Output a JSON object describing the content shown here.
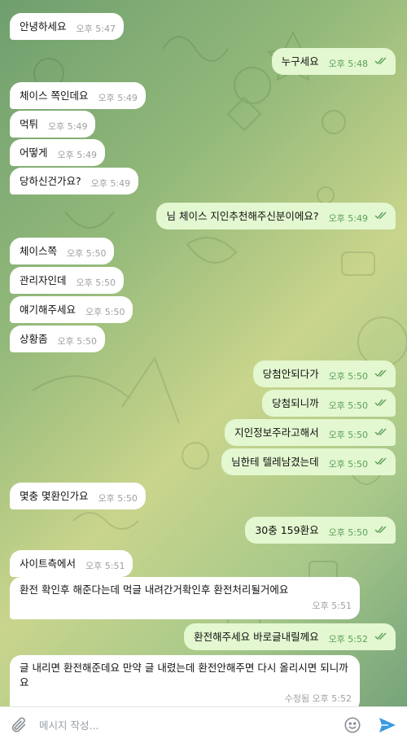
{
  "messages": [
    {
      "dir": "in",
      "text": "안녕하세요",
      "time": "오후 5:47"
    },
    {
      "dir": "out",
      "text": "누구세요",
      "time": "오후 5:48"
    },
    {
      "dir": "in",
      "text": "체이스 쪽인데요",
      "time": "오후 5:49"
    },
    {
      "dir": "in",
      "text": "먹튀",
      "time": "오후 5:49"
    },
    {
      "dir": "in",
      "text": "어떻게",
      "time": "오후 5:49"
    },
    {
      "dir": "in",
      "text": "당하신건가요?",
      "time": "오후 5:49"
    },
    {
      "dir": "out",
      "text": "님 체이스 지인추천해주신분이에요?",
      "time": "오후 5:49"
    },
    {
      "dir": "in",
      "text": "체이스쪽",
      "time": "오후 5:50"
    },
    {
      "dir": "in",
      "text": "관리자인데",
      "time": "오후 5:50"
    },
    {
      "dir": "in",
      "text": "얘기해주세요",
      "time": "오후 5:50"
    },
    {
      "dir": "in",
      "text": "상황좀",
      "time": "오후 5:50"
    },
    {
      "dir": "out",
      "text": "당첨안되다가",
      "time": "오후 5:50"
    },
    {
      "dir": "out",
      "text": "당첨되니까",
      "time": "오후 5:50"
    },
    {
      "dir": "out",
      "text": "지인정보주라고해서",
      "time": "오후 5:50"
    },
    {
      "dir": "out",
      "text": "님한테 텔레남겼는데",
      "time": "오후 5:50"
    },
    {
      "dir": "in",
      "text": "몇충 몇환인가요",
      "time": "오후 5:50"
    },
    {
      "dir": "out",
      "text": "30충 159환요",
      "time": "오후 5:50"
    },
    {
      "dir": "in",
      "text": "사이트측에서",
      "time": "오후 5:51"
    },
    {
      "dir": "in",
      "text": "환전 확인후 해준다는데 먹글 내려간거확인후 환전처리될거에요",
      "time": "오후 5:51"
    },
    {
      "dir": "out",
      "text": "환전해주세요 바로글내릴께요",
      "time": "오후 5:52"
    },
    {
      "dir": "in",
      "text": "글 내리면 환전해준데요 만약 글 내렸는데 환전안해주면 다시 올리시면 되니까요",
      "time": "수정됨 오후 5:52"
    }
  ],
  "composer": {
    "placeholder": "메시지 작성...",
    "attach_icon": "paperclip-icon",
    "emoji_icon": "smiley-icon",
    "send_icon": "send-arrow-icon"
  },
  "colors": {
    "incoming_bubble": "#ffffff",
    "outgoing_bubble": "#e3f7d0",
    "outgoing_meta": "#5aa15b",
    "send_accent": "#3a9be0"
  }
}
